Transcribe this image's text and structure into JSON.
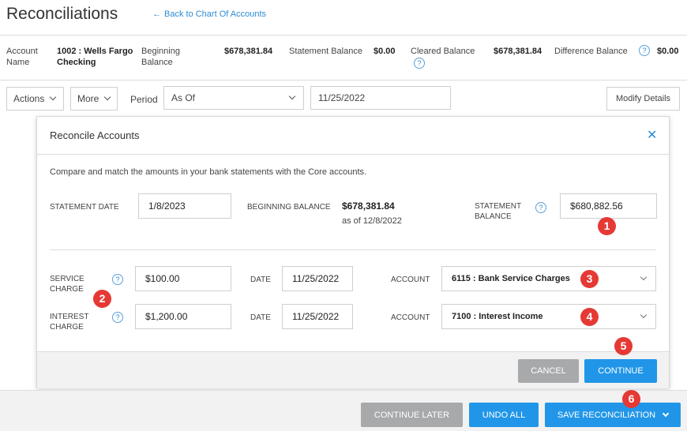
{
  "header": {
    "title": "Reconciliations",
    "back_link": "Back to Chart Of Accounts",
    "back_arrow": "←"
  },
  "summary": {
    "account_name_label": "Account Name",
    "account_name_value": "1002 : Wells Fargo Checking",
    "beginning_balance_label": "Beginning Balance",
    "beginning_balance_value": "$678,381.84",
    "statement_balance_label": "Statement Balance",
    "statement_balance_value": "$0.00",
    "cleared_balance_label": "Cleared Balance",
    "cleared_balance_value": "$678,381.84",
    "difference_balance_label": "Difference Balance",
    "difference_balance_value": "$0.00",
    "help_glyph": "?"
  },
  "toolbar": {
    "actions_label": "Actions",
    "more_label": "More",
    "period_label": "Period",
    "period_value": "As Of",
    "date_value": "11/25/2022",
    "modify_details_label": "Modify Details"
  },
  "modal": {
    "title": "Reconcile Accounts",
    "close_glyph": "✕",
    "intro": "Compare and match the amounts in your bank statements with the Core accounts.",
    "statement_date_label": "STATEMENT DATE",
    "statement_date_value": "1/8/2023",
    "beginning_balance_label": "BEGINNING BALANCE",
    "beginning_balance_value": "$678,381.84",
    "beginning_balance_asof": "as of 12/8/2022",
    "statement_balance_label": "STATEMENT BALANCE",
    "statement_balance_value": "$680,882.56",
    "service_charge_label": "SERVICE CHARGE",
    "service_charge_value": "$100.00",
    "service_date_label": "DATE",
    "service_date_value": "11/25/2022",
    "service_account_label": "ACCOUNT",
    "service_account_value": "6115 : Bank Service Charges",
    "interest_charge_label": "INTEREST CHARGE",
    "interest_charge_value": "$1,200.00",
    "interest_date_label": "DATE",
    "interest_date_value": "11/25/2022",
    "interest_account_label": "ACCOUNT",
    "interest_account_value": "7100 : Interest Income",
    "cancel_label": "CANCEL",
    "continue_label": "CONTINUE"
  },
  "bottom": {
    "continue_later_label": "CONTINUE LATER",
    "undo_all_label": "UNDO ALL",
    "save_reconciliation_label": "SAVE RECONCILIATION"
  },
  "badges": [
    "1",
    "2",
    "3",
    "4",
    "5",
    "6"
  ],
  "colors": {
    "accent_blue": "#2196e8",
    "link_blue": "#2d8bd4",
    "badge_red": "#e53935",
    "grey_button": "#a7a9ab"
  }
}
